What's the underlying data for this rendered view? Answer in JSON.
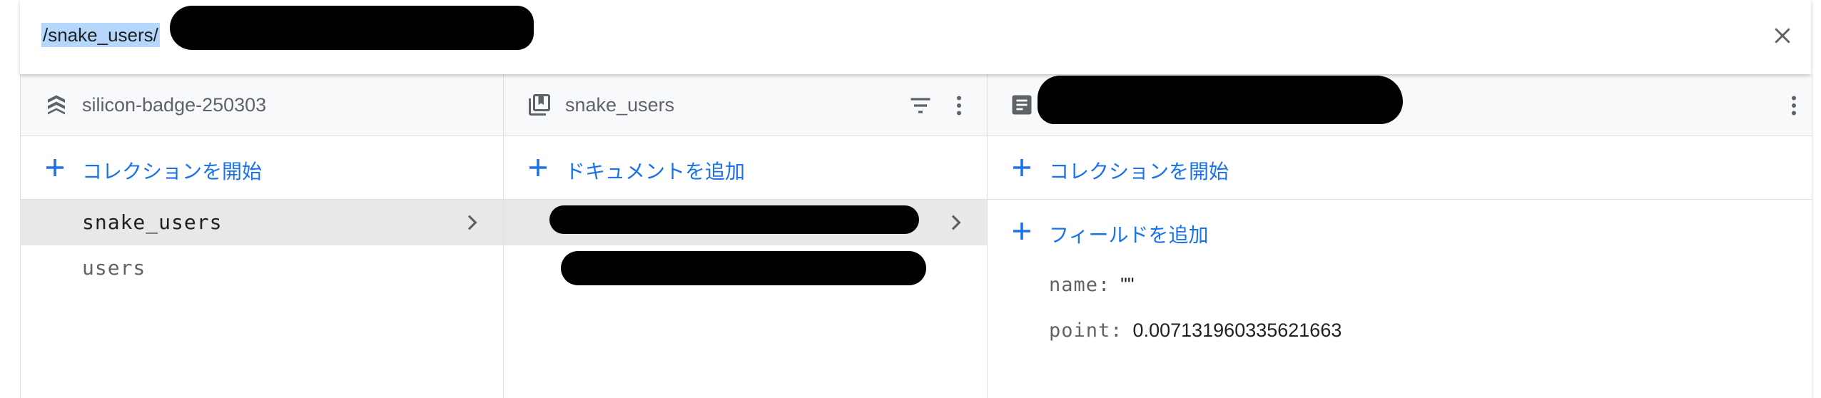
{
  "path_bar": {
    "path": "/snake_users/",
    "close_icon": "close-icon"
  },
  "panels": {
    "root": {
      "title": "silicon-badge-250303",
      "icon": "firestore-database-icon",
      "add_label": "コレクションを開始",
      "collections": [
        {
          "label": "snake_users",
          "selected": true
        },
        {
          "label": "users",
          "selected": false
        }
      ]
    },
    "collection": {
      "title": "snake_users",
      "icon": "collection-icon",
      "add_label": "ドキュメントを追加"
    },
    "document": {
      "icon": "document-icon",
      "add_collection_label": "コレクションを開始",
      "add_field_label": "フィールドを追加",
      "fields": [
        {
          "key": "name:",
          "value": "\"\""
        },
        {
          "key": "point:",
          "value": "0.007131960335621663"
        }
      ]
    }
  },
  "colors": {
    "accent": "#1a73e8",
    "header_bg": "#f8f9fa",
    "selected_bg": "#e8e8e8",
    "border": "#e0e0e0"
  }
}
